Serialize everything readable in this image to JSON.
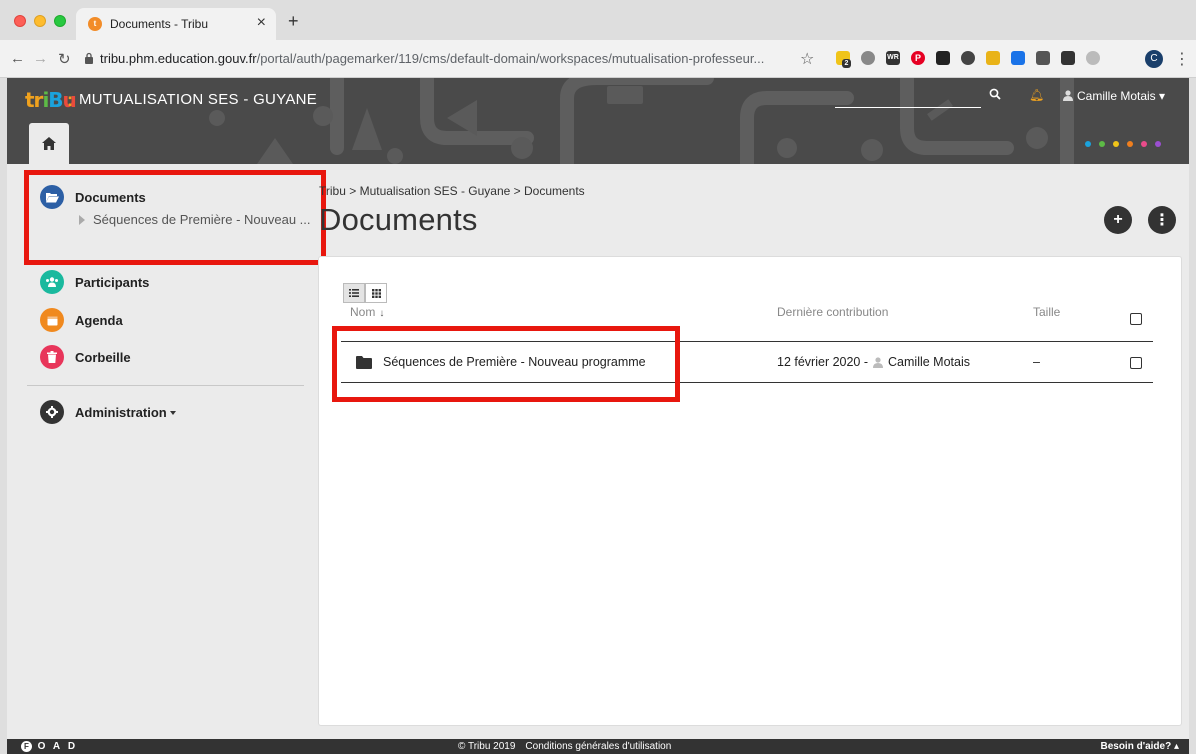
{
  "browser": {
    "tab_title": "Documents - Tribu",
    "tab_favicon": "tribu-favicon",
    "new_tab_label": "+",
    "close_tab_label": "×",
    "url_host": "tribu.phm.education.gouv.fr",
    "url_path": "/portal/auth/pagemarker/119/cms/default-domain/workspaces/mutualisation-professeur...",
    "profile_initial": "C",
    "extension_badge": "2",
    "icons": [
      "back-icon",
      "forward-icon",
      "reload-icon",
      "lock-icon",
      "star-icon",
      "menu-icon"
    ]
  },
  "header": {
    "logo_parts": [
      "tr",
      "i",
      "B",
      "u"
    ],
    "logo_separator": ":",
    "workspace_title": "MUTUALISATION SES - GUYANE",
    "search_placeholder": "",
    "user_name": "Camille Motais",
    "dot_colors": [
      "#1ba3dd",
      "#5dbb46",
      "#f0c419",
      "#f07f1e",
      "#e94b8a",
      "#9b4fd1"
    ]
  },
  "sidebar": {
    "documents": {
      "label": "Documents",
      "color": "#2c5fa5"
    },
    "documents_child": {
      "label": "Séquences de Première - Nouveau ..."
    },
    "participants": {
      "label": "Participants",
      "color": "#1ab99e"
    },
    "agenda": {
      "label": "Agenda",
      "color": "#f0891e"
    },
    "corbeille": {
      "label": "Corbeille",
      "color": "#e8355a"
    },
    "administration": {
      "label": "Administration",
      "color": "#333333"
    }
  },
  "main": {
    "breadcrumb": "Tribu > Mutualisation SES - Guyane > Documents",
    "title": "Documents",
    "add_button": "+",
    "more_button": "⋮",
    "columns": {
      "name": "Nom",
      "sort_indicator": "🡓",
      "last_contribution": "Dernière contribution",
      "size": "Taille"
    },
    "rows": [
      {
        "name": "Séquences de Première - Nouveau programme",
        "date": "12 février 2020 -",
        "author": "Camille Motais",
        "size": "–"
      }
    ]
  },
  "footer": {
    "foad_letters": [
      "F",
      "O",
      "A",
      "D"
    ],
    "copyright": "© Tribu 2019",
    "terms": "Conditions générales d'utilisation",
    "help": "Besoin d'aide? ▴"
  },
  "annotation": {
    "highlight_color": "#e8170e"
  }
}
